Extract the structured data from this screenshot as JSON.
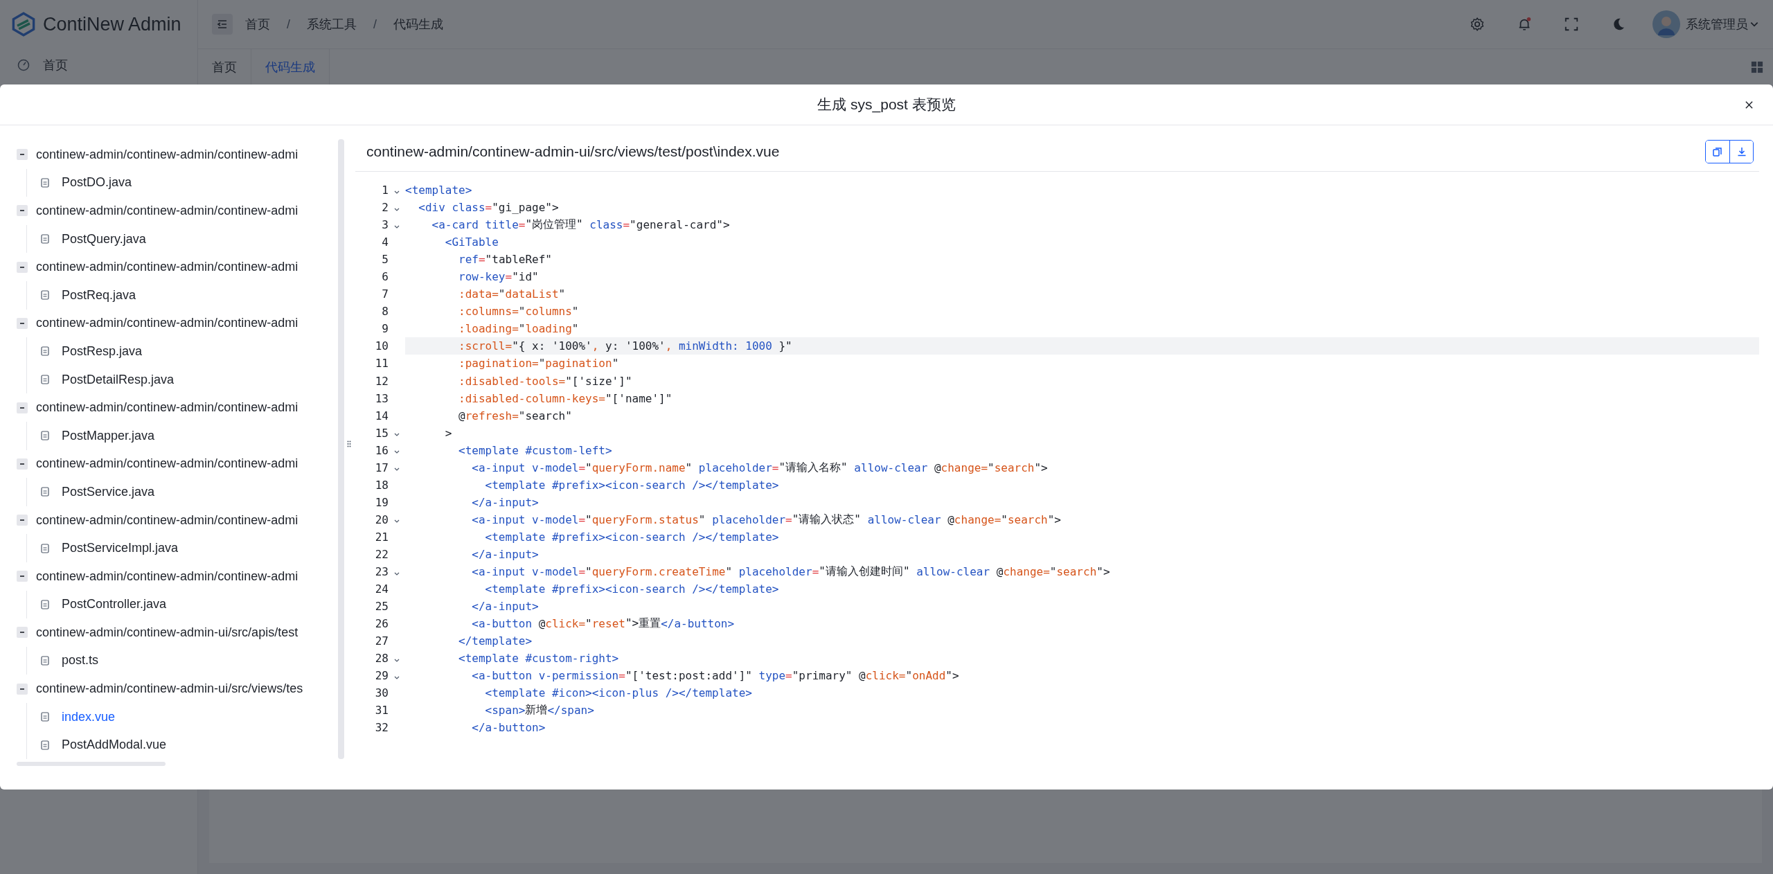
{
  "app": {
    "logo_text": "ContiNew Admin",
    "menu": [
      {
        "label": "首页",
        "selected": false
      }
    ]
  },
  "header": {
    "breadcrumb": [
      {
        "label": "首页"
      },
      {
        "sep": "/",
        "label": "系统工具"
      },
      {
        "sep": "/",
        "label": "代码生成"
      }
    ],
    "user": "系统管理员"
  },
  "tabs": [
    {
      "label": "首页",
      "selected": false
    },
    {
      "label": "代码生成",
      "selected": true
    }
  ],
  "modal": {
    "title": "生成 sys_post 表预览",
    "tree": [
      {
        "label": "continew-admin/continew-admin/continew-admi",
        "expanded": true,
        "children": [
          {
            "label": "PostDO.java",
            "selected": false
          }
        ]
      },
      {
        "label": "continew-admin/continew-admin/continew-admi",
        "expanded": true,
        "children": [
          {
            "label": "PostQuery.java",
            "selected": false
          }
        ]
      },
      {
        "label": "continew-admin/continew-admin/continew-admi",
        "expanded": true,
        "children": [
          {
            "label": "PostReq.java",
            "selected": false
          }
        ]
      },
      {
        "label": "continew-admin/continew-admin/continew-admi",
        "expanded": true,
        "children": [
          {
            "label": "PostResp.java",
            "selected": false
          },
          {
            "label": "PostDetailResp.java",
            "selected": false
          }
        ]
      },
      {
        "label": "continew-admin/continew-admin/continew-admi",
        "expanded": true,
        "children": [
          {
            "label": "PostMapper.java",
            "selected": false
          }
        ]
      },
      {
        "label": "continew-admin/continew-admin/continew-admi",
        "expanded": true,
        "children": [
          {
            "label": "PostService.java",
            "selected": false
          }
        ]
      },
      {
        "label": "continew-admin/continew-admin/continew-admi",
        "expanded": true,
        "children": [
          {
            "label": "PostServiceImpl.java",
            "selected": false
          }
        ]
      },
      {
        "label": "continew-admin/continew-admin/continew-admi",
        "expanded": true,
        "children": [
          {
            "label": "PostController.java",
            "selected": false
          }
        ]
      },
      {
        "label": "continew-admin/continew-admin-ui/src/apis/test",
        "expanded": true,
        "children": [
          {
            "label": "post.ts",
            "selected": false
          }
        ]
      },
      {
        "label": "continew-admin/continew-admin-ui/src/views/tes",
        "expanded": true,
        "children": [
          {
            "label": "index.vue",
            "selected": true
          },
          {
            "label": "PostAddModal.vue",
            "selected": false
          }
        ]
      }
    ],
    "file_path": "continew-admin/continew-admin-ui/src/views/test/post\\index.vue",
    "code": [
      {
        "n": "1",
        "fold": true,
        "current": false,
        "tokens": [
          {
            "kind": "tag",
            "text": "<template>"
          }
        ]
      },
      {
        "n": "2",
        "fold": true,
        "current": false,
        "tokens": [
          {
            "kind": "tag",
            "text": "  <div class"
          },
          {
            "kind": "eq",
            "text": "="
          },
          {
            "kind": "str",
            "text": "\"gi_page\">"
          }
        ]
      },
      {
        "n": "3",
        "fold": true,
        "current": false,
        "tokens": [
          {
            "kind": "tag",
            "text": "    <a-card title"
          },
          {
            "kind": "eq",
            "text": "="
          },
          {
            "kind": "str",
            "text": "\"岗位管理\""
          },
          {
            "kind": "tag",
            "text": " class"
          },
          {
            "kind": "eq",
            "text": "="
          },
          {
            "kind": "str",
            "text": "\"general-card\">"
          }
        ]
      },
      {
        "n": "4",
        "fold": false,
        "current": false,
        "tokens": [
          {
            "kind": "tag",
            "text": "      <GiTable"
          }
        ]
      },
      {
        "n": "5",
        "fold": false,
        "current": false,
        "tokens": [
          {
            "kind": "tag",
            "text": "        ref"
          },
          {
            "kind": "eq",
            "text": "="
          },
          {
            "kind": "str",
            "text": "\"tableRef\""
          }
        ]
      },
      {
        "n": "6",
        "fold": false,
        "current": false,
        "tokens": [
          {
            "kind": "tag",
            "text": "        row-key"
          },
          {
            "kind": "eq",
            "text": "="
          },
          {
            "kind": "str",
            "text": "\"id\""
          }
        ]
      },
      {
        "n": "7",
        "fold": false,
        "current": false,
        "tokens": [
          {
            "kind": "bind",
            "text": "        :data="
          },
          {
            "kind": "str",
            "text": "\""
          },
          {
            "kind": "bind",
            "text": "dataList"
          },
          {
            "kind": "str",
            "text": "\""
          }
        ]
      },
      {
        "n": "8",
        "fold": false,
        "current": false,
        "tokens": [
          {
            "kind": "bind",
            "text": "        :columns="
          },
          {
            "kind": "str",
            "text": "\""
          },
          {
            "kind": "bind",
            "text": "columns"
          },
          {
            "kind": "str",
            "text": "\""
          }
        ]
      },
      {
        "n": "9",
        "fold": false,
        "current": false,
        "tokens": [
          {
            "kind": "bind",
            "text": "        :loading="
          },
          {
            "kind": "str",
            "text": "\""
          },
          {
            "kind": "bind",
            "text": "loading"
          },
          {
            "kind": "str",
            "text": "\""
          }
        ]
      },
      {
        "n": "10",
        "fold": false,
        "current": true,
        "tokens": [
          {
            "kind": "bind",
            "text": "        :scroll="
          },
          {
            "kind": "str",
            "text": "\"{ x: '100%'"
          },
          {
            "kind": "bind",
            "text": ","
          },
          {
            "kind": "str",
            "text": " y: '100%'"
          },
          {
            "kind": "bind",
            "text": ","
          },
          {
            "kind": "tag",
            "text": " minWidth: 1000"
          },
          {
            "kind": "str",
            "text": " }\""
          }
        ]
      },
      {
        "n": "11",
        "fold": false,
        "current": false,
        "tokens": [
          {
            "kind": "bind",
            "text": "        :pagination="
          },
          {
            "kind": "str",
            "text": "\""
          },
          {
            "kind": "bind",
            "text": "pagination"
          },
          {
            "kind": "str",
            "text": "\""
          }
        ]
      },
      {
        "n": "12",
        "fold": false,
        "current": false,
        "tokens": [
          {
            "kind": "bind",
            "text": "        :disabled-tools="
          },
          {
            "kind": "str",
            "text": "\"['size']\""
          }
        ]
      },
      {
        "n": "13",
        "fold": false,
        "current": false,
        "tokens": [
          {
            "kind": "bind",
            "text": "        :disabled-column-keys="
          },
          {
            "kind": "str",
            "text": "\"['name']\""
          }
        ]
      },
      {
        "n": "14",
        "fold": false,
        "current": false,
        "tokens": [
          {
            "kind": "str",
            "text": "        @"
          },
          {
            "kind": "bind",
            "text": "refresh="
          },
          {
            "kind": "str",
            "text": "\"search\""
          }
        ]
      },
      {
        "n": "15",
        "fold": true,
        "current": false,
        "tokens": [
          {
            "kind": "str",
            "text": "      >"
          }
        ]
      },
      {
        "n": "16",
        "fold": true,
        "current": false,
        "tokens": [
          {
            "kind": "tag",
            "text": "        <template #custom-left>"
          }
        ]
      },
      {
        "n": "17",
        "fold": true,
        "current": false,
        "tokens": [
          {
            "kind": "tag",
            "text": "          <a-input v-model"
          },
          {
            "kind": "eq",
            "text": "="
          },
          {
            "kind": "str",
            "text": "\""
          },
          {
            "kind": "bind",
            "text": "queryForm.name"
          },
          {
            "kind": "str",
            "text": "\""
          },
          {
            "kind": "tag",
            "text": " placeholder"
          },
          {
            "kind": "eq",
            "text": "="
          },
          {
            "kind": "str",
            "text": "\"请输入名称\""
          },
          {
            "kind": "tag",
            "text": " allow-clear"
          },
          {
            "kind": "str",
            "text": " @"
          },
          {
            "kind": "bind",
            "text": "change="
          },
          {
            "kind": "str",
            "text": "\""
          },
          {
            "kind": "bind",
            "text": "search"
          },
          {
            "kind": "str",
            "text": "\">"
          }
        ]
      },
      {
        "n": "18",
        "fold": false,
        "current": false,
        "tokens": [
          {
            "kind": "tag",
            "text": "            <template #prefix><icon-search /></template>"
          }
        ]
      },
      {
        "n": "19",
        "fold": false,
        "current": false,
        "tokens": [
          {
            "kind": "tag",
            "text": "          </a-input>"
          }
        ]
      },
      {
        "n": "20",
        "fold": true,
        "current": false,
        "tokens": [
          {
            "kind": "tag",
            "text": "          <a-input v-model"
          },
          {
            "kind": "eq",
            "text": "="
          },
          {
            "kind": "str",
            "text": "\""
          },
          {
            "kind": "bind",
            "text": "queryForm.status"
          },
          {
            "kind": "str",
            "text": "\""
          },
          {
            "kind": "tag",
            "text": " placeholder"
          },
          {
            "kind": "eq",
            "text": "="
          },
          {
            "kind": "str",
            "text": "\"请输入状态\""
          },
          {
            "kind": "tag",
            "text": " allow-clear"
          },
          {
            "kind": "str",
            "text": " @"
          },
          {
            "kind": "bind",
            "text": "change="
          },
          {
            "kind": "str",
            "text": "\""
          },
          {
            "kind": "bind",
            "text": "search"
          },
          {
            "kind": "str",
            "text": "\">"
          }
        ]
      },
      {
        "n": "21",
        "fold": false,
        "current": false,
        "tokens": [
          {
            "kind": "tag",
            "text": "            <template #prefix><icon-search /></template>"
          }
        ]
      },
      {
        "n": "22",
        "fold": false,
        "current": false,
        "tokens": [
          {
            "kind": "tag",
            "text": "          </a-input>"
          }
        ]
      },
      {
        "n": "23",
        "fold": true,
        "current": false,
        "tokens": [
          {
            "kind": "tag",
            "text": "          <a-input v-model"
          },
          {
            "kind": "eq",
            "text": "="
          },
          {
            "kind": "str",
            "text": "\""
          },
          {
            "kind": "bind",
            "text": "queryForm.createTime"
          },
          {
            "kind": "str",
            "text": "\""
          },
          {
            "kind": "tag",
            "text": " placeholder"
          },
          {
            "kind": "eq",
            "text": "="
          },
          {
            "kind": "str",
            "text": "\"请输入创建时间\""
          },
          {
            "kind": "tag",
            "text": " allow-clear"
          },
          {
            "kind": "str",
            "text": " @"
          },
          {
            "kind": "bind",
            "text": "change="
          },
          {
            "kind": "str",
            "text": "\""
          },
          {
            "kind": "bind",
            "text": "search"
          },
          {
            "kind": "str",
            "text": "\">"
          }
        ]
      },
      {
        "n": "24",
        "fold": false,
        "current": false,
        "tokens": [
          {
            "kind": "tag",
            "text": "            <template #prefix><icon-search /></template>"
          }
        ]
      },
      {
        "n": "25",
        "fold": false,
        "current": false,
        "tokens": [
          {
            "kind": "tag",
            "text": "          </a-input>"
          }
        ]
      },
      {
        "n": "26",
        "fold": false,
        "current": false,
        "tokens": [
          {
            "kind": "tag",
            "text": "          <a-button"
          },
          {
            "kind": "str",
            "text": " @"
          },
          {
            "kind": "bind",
            "text": "click="
          },
          {
            "kind": "str",
            "text": "\""
          },
          {
            "kind": "bind",
            "text": "reset"
          },
          {
            "kind": "str",
            "text": "\">重置"
          },
          {
            "kind": "tag",
            "text": "</a-button>"
          }
        ]
      },
      {
        "n": "27",
        "fold": false,
        "current": false,
        "tokens": [
          {
            "kind": "tag",
            "text": "        </template>"
          }
        ]
      },
      {
        "n": "28",
        "fold": true,
        "current": false,
        "tokens": [
          {
            "kind": "tag",
            "text": "        <template #custom-right>"
          }
        ]
      },
      {
        "n": "29",
        "fold": true,
        "current": false,
        "tokens": [
          {
            "kind": "tag",
            "text": "          <a-button v-permission"
          },
          {
            "kind": "eq",
            "text": "="
          },
          {
            "kind": "str",
            "text": "\"['test:post:add']\""
          },
          {
            "kind": "tag",
            "text": " type"
          },
          {
            "kind": "eq",
            "text": "="
          },
          {
            "kind": "str",
            "text": "\"primary\""
          },
          {
            "kind": "str",
            "text": " @"
          },
          {
            "kind": "bind",
            "text": "click="
          },
          {
            "kind": "str",
            "text": "\""
          },
          {
            "kind": "bind",
            "text": "onAdd"
          },
          {
            "kind": "str",
            "text": "\">"
          }
        ]
      },
      {
        "n": "30",
        "fold": false,
        "current": false,
        "tokens": [
          {
            "kind": "tag",
            "text": "            <template #icon><icon-plus /></template>"
          }
        ]
      },
      {
        "n": "31",
        "fold": false,
        "current": false,
        "tokens": [
          {
            "kind": "tag",
            "text": "            <span>"
          },
          {
            "kind": "str",
            "text": "新增"
          },
          {
            "kind": "tag",
            "text": "</span>"
          }
        ]
      },
      {
        "n": "32",
        "fold": false,
        "current": false,
        "tokens": [
          {
            "kind": "tag",
            "text": "          </a-button>"
          }
        ]
      }
    ]
  }
}
